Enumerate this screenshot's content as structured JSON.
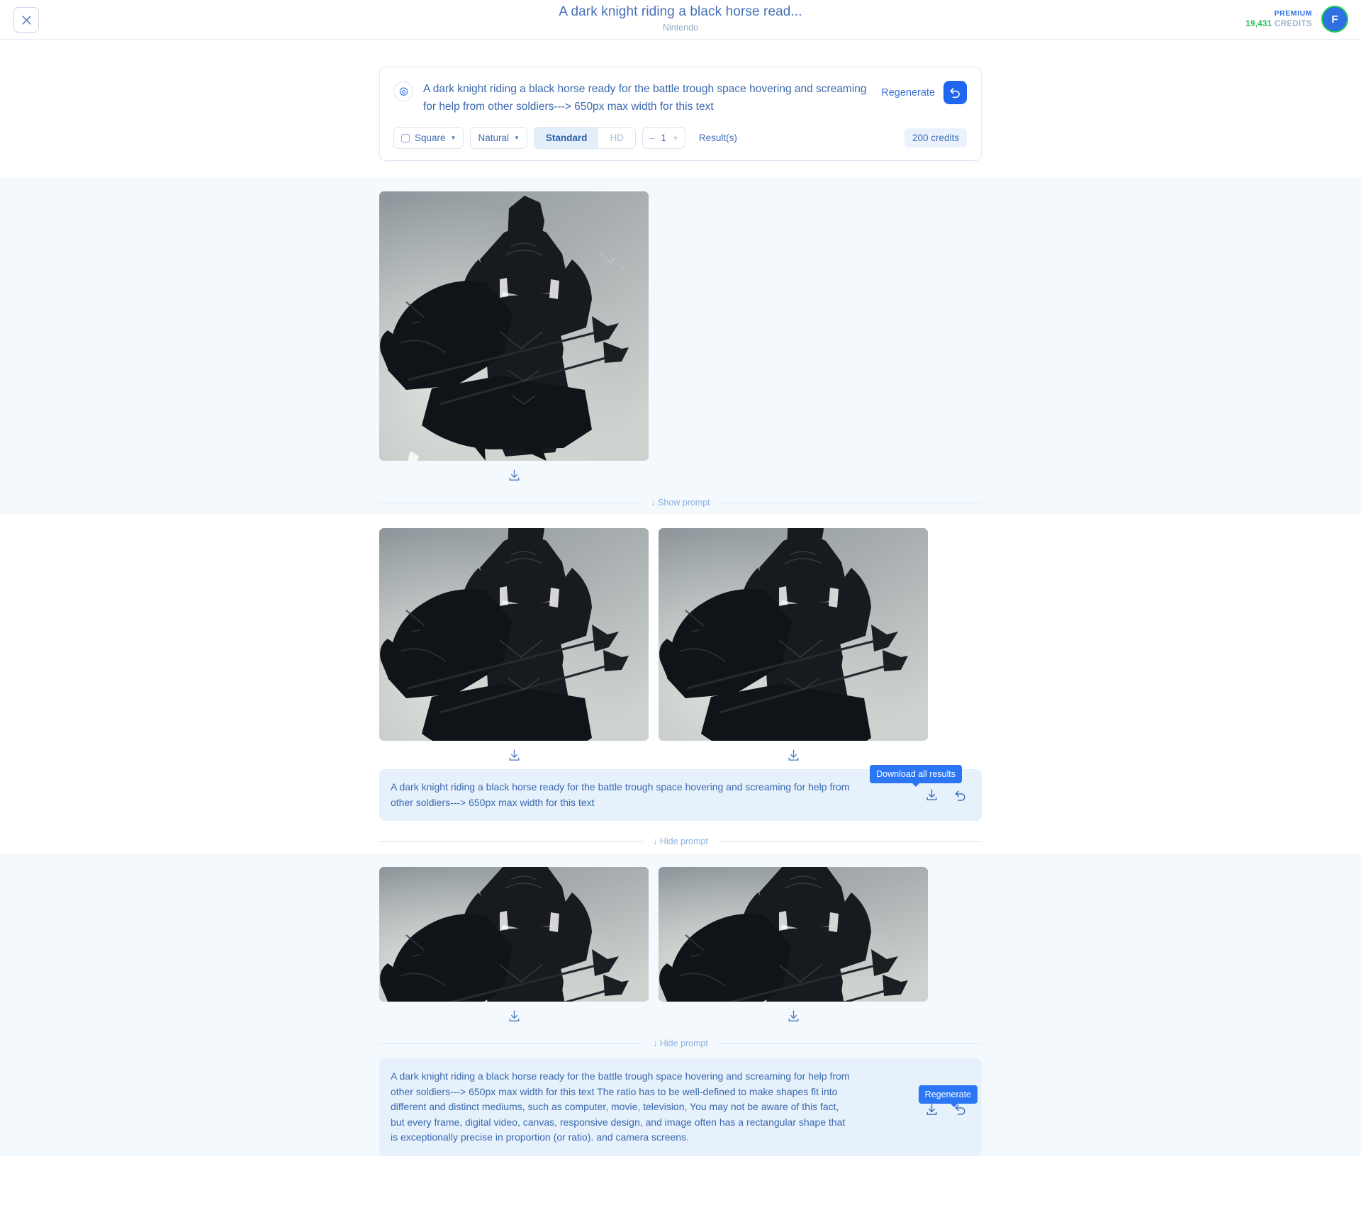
{
  "header": {
    "close_icon": "close-icon",
    "title": "A dark knight riding a black horse read...",
    "subtitle": "Nintendo",
    "premium_label": "PREMIUM",
    "credits_value": "19,431",
    "credits_word": "CREDITS",
    "avatar_initial": "F"
  },
  "prompt_card": {
    "gear_icon": "settings-gear-icon",
    "prompt_text": "A dark knight riding a black horse ready for the battle trough space hovering and screaming for help from other soldiers---> 650px max width for this text",
    "regenerate_label": "Regenerate",
    "regenerate_icon": "undo-arrow-icon",
    "toolbar": {
      "shape_label": "Square",
      "style_label": "Natural",
      "quality_standard": "Standard",
      "quality_hd": "HD",
      "stepper_minus": "–",
      "stepper_value": "1",
      "stepper_plus": "+",
      "results_label": "Result(s)",
      "credits_cost": "200 credits"
    }
  },
  "results": [
    {
      "id": "result-1",
      "image_count": 1,
      "image_alt": "A dark knight riding a black horse",
      "download_icon": "download-icon",
      "toggle_label": "↓  Show prompt",
      "prompt_visible": false,
      "prompt_text": ""
    },
    {
      "id": "result-2",
      "image_count": 2,
      "image_alt": "A dark knight riding a black horse",
      "download_icon": "download-icon",
      "toggle_label": "↓  Hide prompt",
      "prompt_visible": true,
      "prompt_text": "A dark knight riding a black horse ready for the battle trough space hovering and screaming for help from other soldiers---> 650px max width for this text",
      "tooltip": "Download all results",
      "download_all_icon": "download-icon",
      "regenerate_icon": "undo-arrow-icon"
    },
    {
      "id": "result-3",
      "image_count": 2,
      "image_alt": "A dark knight riding a black horse",
      "download_icon": "download-icon",
      "toggle_label": "↓  Hide prompt",
      "prompt_visible": true,
      "prompt_text": "A dark knight riding a black horse ready for the battle trough space hovering and screaming for help from other soldiers---> 650px max width for this text The ratio has to be well-defined to make shapes fit into different and distinct mediums, such as computer, movie, television, You may not be aware of this fact, but every frame, digital video, canvas, responsive design, and image often has a rectangular shape that is exceptionally precise in proportion (or ratio). and camera screens.",
      "tooltip": "Regenerate",
      "download_all_icon": "download-icon",
      "regenerate_icon": "undo-arrow-icon"
    }
  ],
  "colors": {
    "accent": "#2f6fe4",
    "tint_bg": "#f4f9fe",
    "prompt_bg": "#e6f1fc",
    "text_blue": "#3b68ad",
    "credits_green": "#21c15a"
  }
}
